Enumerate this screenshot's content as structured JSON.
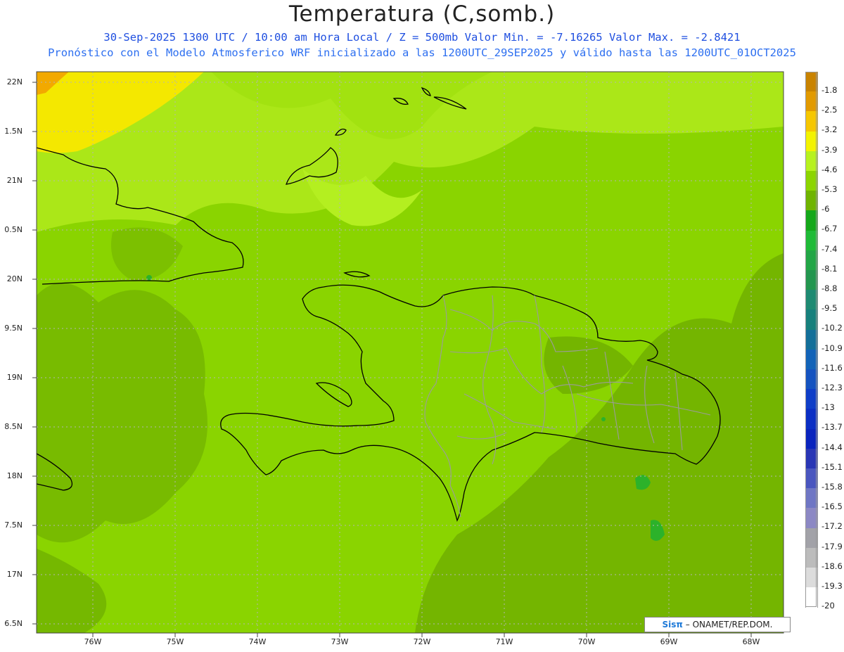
{
  "header": {
    "title": "Temperatura (C,somb.)",
    "line1": "30-Sep-2025  1300 UTC / 10:00 am Hora Local / Z = 500mb  Valor Min. = -7.16265  Valor Max. = -2.8421",
    "line2": "Pronóstico con el Modelo Atmosferico WRF inicializado a las 1200UTC_29SEP2025 y válido hasta las  1200UTC_01OCT2025"
  },
  "axes": {
    "lat_labels": [
      "22N",
      "1.5N",
      "21N",
      "0.5N",
      "20N",
      "9.5N",
      "19N",
      "8.5N",
      "18N",
      "7.5N",
      "17N",
      "6.5N"
    ],
    "lon_labels": [
      "76W",
      "75W",
      "74W",
      "73W",
      "72W",
      "71W",
      "70W",
      "69W",
      "68W"
    ]
  },
  "legend": {
    "labels": [
      "-1.8",
      "-2.5",
      "-3.2",
      "-3.9",
      "-4.6",
      "-5.3",
      "-6",
      "-6.7",
      "-7.4",
      "-8.1",
      "-8.8",
      "-9.5",
      "-10.2",
      "-10.9",
      "-11.6",
      "-12.3",
      "-13",
      "-13.7",
      "-14.4",
      "-15.1",
      "-15.8",
      "-16.5",
      "-17.2",
      "-17.9",
      "-18.6",
      "-19.3",
      "-20"
    ],
    "colors": [
      "#c98300",
      "#e29a00",
      "#f6c700",
      "#f3f300",
      "#b7f21e",
      "#8cd500",
      "#6fb400",
      "#14a81a",
      "#1fbb37",
      "#22a646",
      "#23964f",
      "#1e8a72",
      "#17807c",
      "#136f99",
      "#1263b8",
      "#1553c0",
      "#0f3ec8",
      "#0b2fc4",
      "#0a24be",
      "#2936b5",
      "#4a56bf",
      "#6f76c4",
      "#8c88c4",
      "#a2a2a8",
      "#bcbcbc",
      "#dcdcdc",
      "#ffffff"
    ]
  },
  "credit": {
    "brand": "Sisπ",
    "text": "– ONAMET/REP.DOM."
  },
  "colors": {
    "base_field": "#8ad400",
    "light_field": "#b4ef20",
    "dark_field": "#73b400",
    "warm_field": "#f4e800",
    "orange_field": "#f2a900",
    "coast": "#000000",
    "province_border": "#9c9c9c"
  }
}
